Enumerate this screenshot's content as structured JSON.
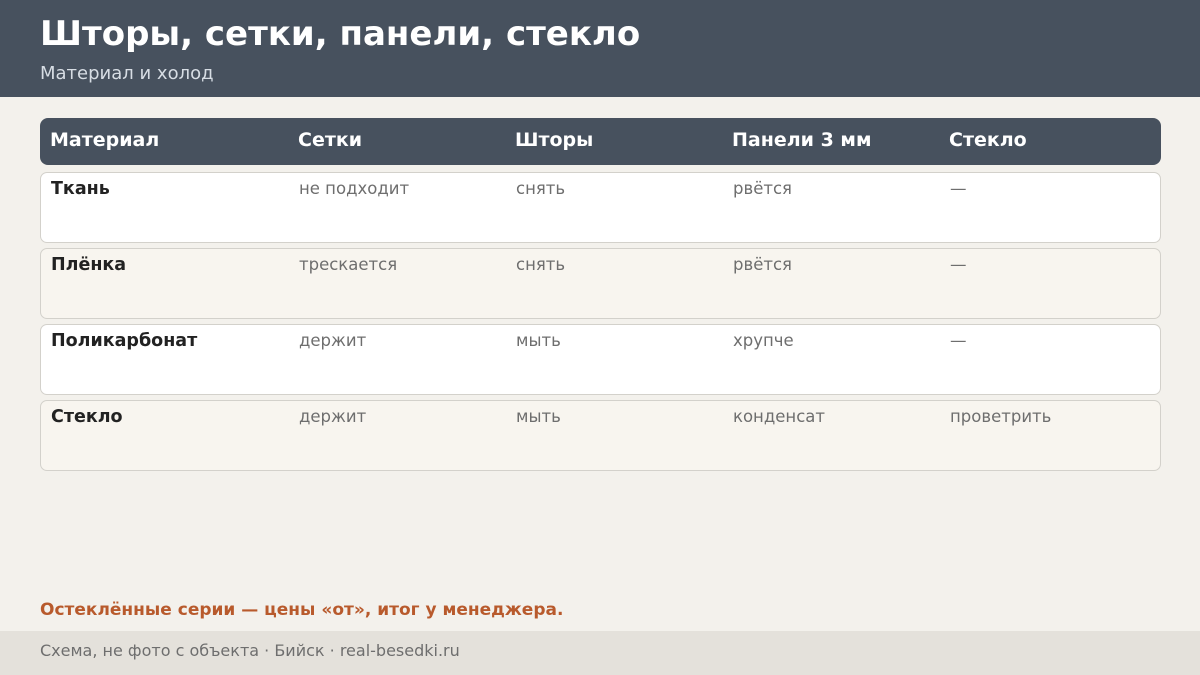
{
  "header": {
    "title": "Шторы, сетки, панели, стекло",
    "subtitle": "Материал и холод"
  },
  "table": {
    "columns": [
      "Материал",
      "Сетки",
      "Шторы",
      "Панели 3 мм",
      "Стекло"
    ],
    "rows": [
      [
        "Ткань",
        "не подходит",
        "снять",
        "рвётся",
        "—"
      ],
      [
        "Плёнка",
        "трескается",
        "снять",
        "рвётся",
        "—"
      ],
      [
        "Поликарбонат",
        "держит",
        "мыть",
        "хрупче",
        "—"
      ],
      [
        "Стекло",
        "держит",
        "мыть",
        "конденсат",
        "проветрить"
      ]
    ]
  },
  "note": "Остеклённые серии — цены «от», итог у менеджера.",
  "footer": {
    "text": "Схема, не фото с объекта  ·  Бийск  ·  real-besedki.ru"
  },
  "colors": {
    "header_bg": "#47515e",
    "accent": "#b85a2c",
    "page_bg": "#f3f1ec"
  }
}
